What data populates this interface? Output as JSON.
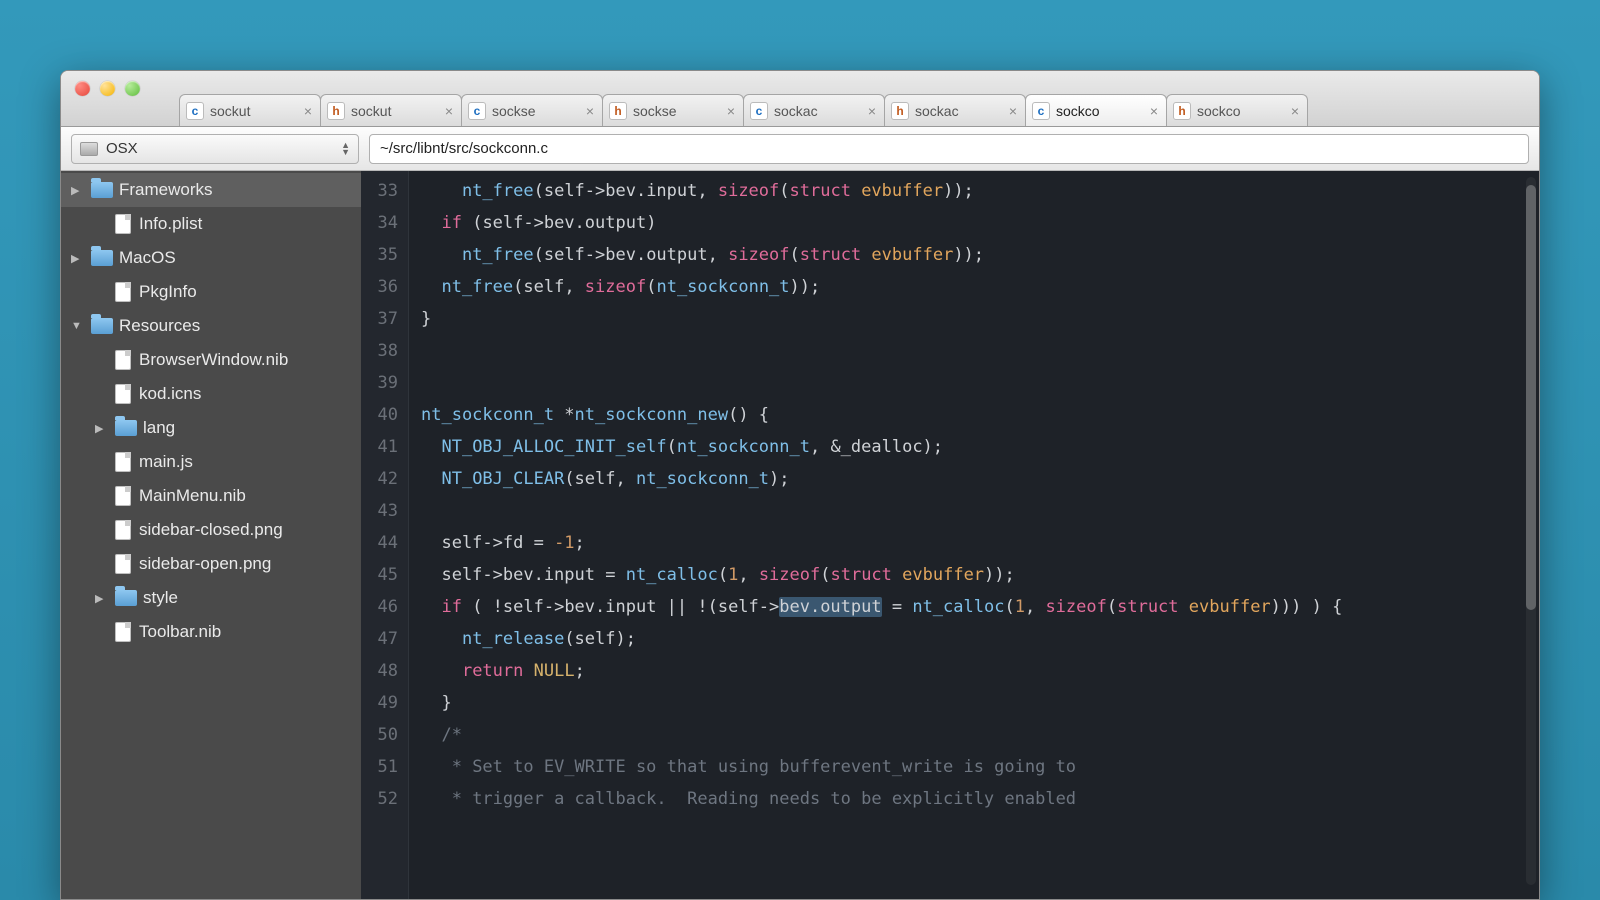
{
  "project_selector": "OSX",
  "path": "~/src/libnt/src/sockconn.c",
  "tabs": [
    {
      "type": "c",
      "label": "sockut",
      "active": false
    },
    {
      "type": "h",
      "label": "sockut",
      "active": false
    },
    {
      "type": "c",
      "label": "sockse",
      "active": false
    },
    {
      "type": "h",
      "label": "sockse",
      "active": false
    },
    {
      "type": "c",
      "label": "sockac",
      "active": false
    },
    {
      "type": "h",
      "label": "sockac",
      "active": false
    },
    {
      "type": "c",
      "label": "sockco",
      "active": true
    },
    {
      "type": "h",
      "label": "sockco",
      "active": false
    }
  ],
  "sidebar": [
    {
      "depth": 1,
      "kind": "folder",
      "disclosure": "▶",
      "label": "Frameworks",
      "selected": true
    },
    {
      "depth": 2,
      "kind": "file",
      "disclosure": "",
      "label": "Info.plist"
    },
    {
      "depth": 1,
      "kind": "folder",
      "disclosure": "▶",
      "label": "MacOS"
    },
    {
      "depth": 2,
      "kind": "file",
      "disclosure": "",
      "label": "PkgInfo"
    },
    {
      "depth": 1,
      "kind": "folder",
      "disclosure": "▼",
      "label": "Resources"
    },
    {
      "depth": 2,
      "kind": "file",
      "disclosure": "",
      "label": "BrowserWindow.nib"
    },
    {
      "depth": 2,
      "kind": "file",
      "disclosure": "",
      "label": "kod.icns"
    },
    {
      "depth": 2,
      "kind": "folder",
      "disclosure": "▶",
      "label": "lang"
    },
    {
      "depth": 2,
      "kind": "file",
      "disclosure": "",
      "label": "main.js"
    },
    {
      "depth": 2,
      "kind": "file",
      "disclosure": "",
      "label": "MainMenu.nib"
    },
    {
      "depth": 2,
      "kind": "file",
      "disclosure": "",
      "label": "sidebar-closed.png"
    },
    {
      "depth": 2,
      "kind": "file",
      "disclosure": "",
      "label": "sidebar-open.png"
    },
    {
      "depth": 2,
      "kind": "folder",
      "disclosure": "▶",
      "label": "style"
    },
    {
      "depth": 2,
      "kind": "file",
      "disclosure": "",
      "label": "Toolbar.nib"
    }
  ],
  "code": {
    "first_line": 33,
    "lines": [
      "    <f>nt_free</f>(self->bev.input, <k>sizeof</k>(<k>struct</k> <s>evbuffer</s>));",
      "  <k>if</k> (self->bev.output)",
      "    <f>nt_free</f>(self->bev.output, <k>sizeof</k>(<k>struct</k> <s>evbuffer</s>));",
      "  <f>nt_free</f>(self, <k>sizeof</k>(<t>nt_sockconn_t</t>));",
      "}",
      "",
      "",
      "<t>nt_sockconn_t</t> *<f>nt_sockconn_new</f>() {",
      "  <f>NT_OBJ_ALLOC_INIT_self</f>(<t>nt_sockconn_t</t>, &_dealloc);",
      "  <f>NT_OBJ_CLEAR</f>(self, <t>nt_sockconn_t</t>);",
      "",
      "  self->fd = <n>-1</n>;",
      "  self->bev.input = <f>nt_calloc</f>(<n>1</n>, <k>sizeof</k>(<k>struct</k> <s>evbuffer</s>));",
      "  <k>if</k> ( !self->bev.input || !(self-><sel>bev.output</sel> = <f>nt_calloc</f>(<n>1</n>, <k>sizeof</k>(<k>struct</k> <s>evbuffer</s>))) ) {",
      "    <f>nt_release</f>(self);",
      "    <k>return</k> <c>NULL</c>;",
      "  }",
      "  <m>/*</m>",
      "  <m> * Set to EV_WRITE so that using bufferevent_write is going to</m>",
      "  <m> * trigger a callback.  Reading needs to be explicitly enabled</m>"
    ]
  }
}
